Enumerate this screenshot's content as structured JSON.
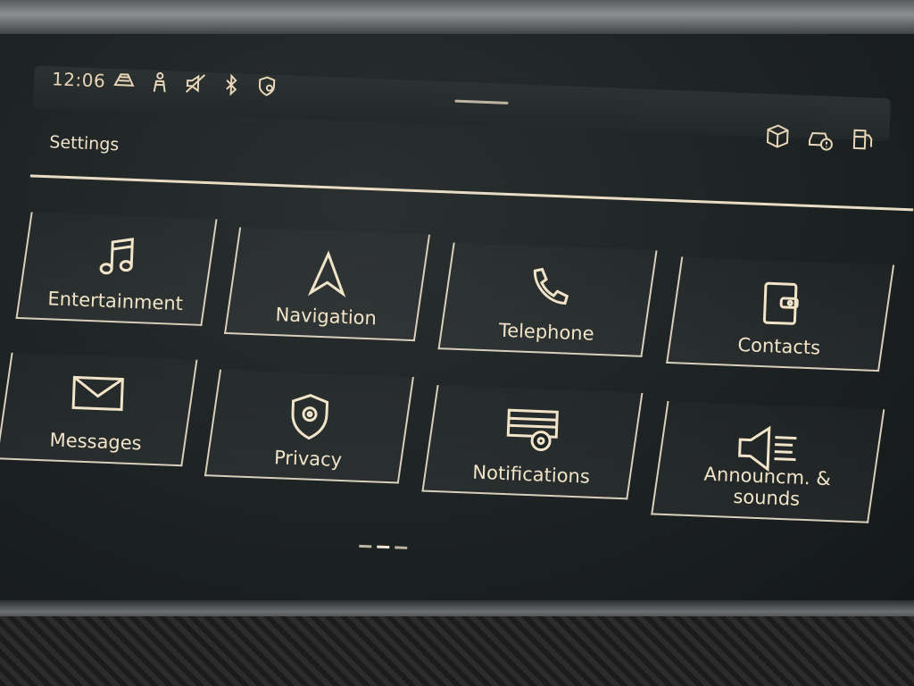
{
  "status_bar": {
    "time": "12:06",
    "icons": [
      "traffic-sign-icon",
      "person-icon",
      "speaker-muted-icon",
      "bluetooth-icon",
      "location-shield-icon"
    ],
    "right_icons": [
      "package-icon",
      "car-alert-icon",
      "fuel-icon"
    ]
  },
  "page": {
    "title": "Settings"
  },
  "tiles": [
    {
      "label": "Entertainment",
      "icon": "music-note-icon"
    },
    {
      "label": "Navigation",
      "icon": "navigation-arrow-icon"
    },
    {
      "label": "Telephone",
      "icon": "phone-icon"
    },
    {
      "label": "Contacts",
      "icon": "contacts-book-icon"
    },
    {
      "label": "Messages",
      "icon": "envelope-icon"
    },
    {
      "label": "Privacy",
      "icon": "privacy-shield-icon"
    },
    {
      "label": "Notifications",
      "icon": "notification-settings-icon"
    },
    {
      "label": "Announcm. &\nsounds",
      "icon": "speaker-sound-icon"
    }
  ],
  "pager": {
    "pages": 3,
    "current": 2
  },
  "colors": {
    "accent": "#f1e4c9",
    "background": "#1d2222"
  }
}
